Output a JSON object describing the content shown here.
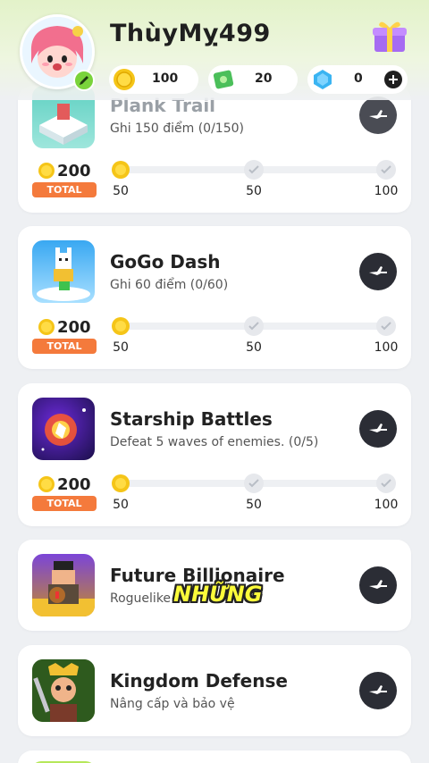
{
  "profile": {
    "username": "ThùyMỵ499"
  },
  "currencies": {
    "coins": "100",
    "cash": "20",
    "gems": "0"
  },
  "games": [
    {
      "title": "Plank Trail",
      "desc": "Ghi 150 điểm (0/150)",
      "reward": "200",
      "badge": "TOTAL",
      "milestones": [
        "50",
        "50",
        "100"
      ],
      "progress": 0
    },
    {
      "title": "GoGo Dash",
      "desc": "Ghi 60 điểm (0/60)",
      "reward": "200",
      "badge": "TOTAL",
      "milestones": [
        "50",
        "50",
        "100"
      ],
      "progress": 0
    },
    {
      "title": "Starship Battles",
      "desc": "Defeat 5 waves of enemies. (0/5)",
      "reward": "200",
      "badge": "TOTAL",
      "milestones": [
        "50",
        "50",
        "100"
      ],
      "progress": 0
    },
    {
      "title": "Future Billionaire",
      "desc": "Roguelike"
    },
    {
      "title": "Kingdom Defense",
      "desc": "Nâng cấp và bảo vệ"
    }
  ],
  "overlay": {
    "text": "NHỮNG"
  },
  "colors": {
    "accent_orange": "#f47a3c",
    "play_button": "#2b2d35",
    "header_green": "#e3f2c9",
    "coin_gold": "#f5c518"
  },
  "icons": {
    "play": "play-icon",
    "coin": "coin-icon",
    "cash": "cash-icon",
    "gem": "gem-icon",
    "add": "plus-icon",
    "gift": "gift-icon",
    "edit": "pencil-icon",
    "check": "check-icon"
  }
}
